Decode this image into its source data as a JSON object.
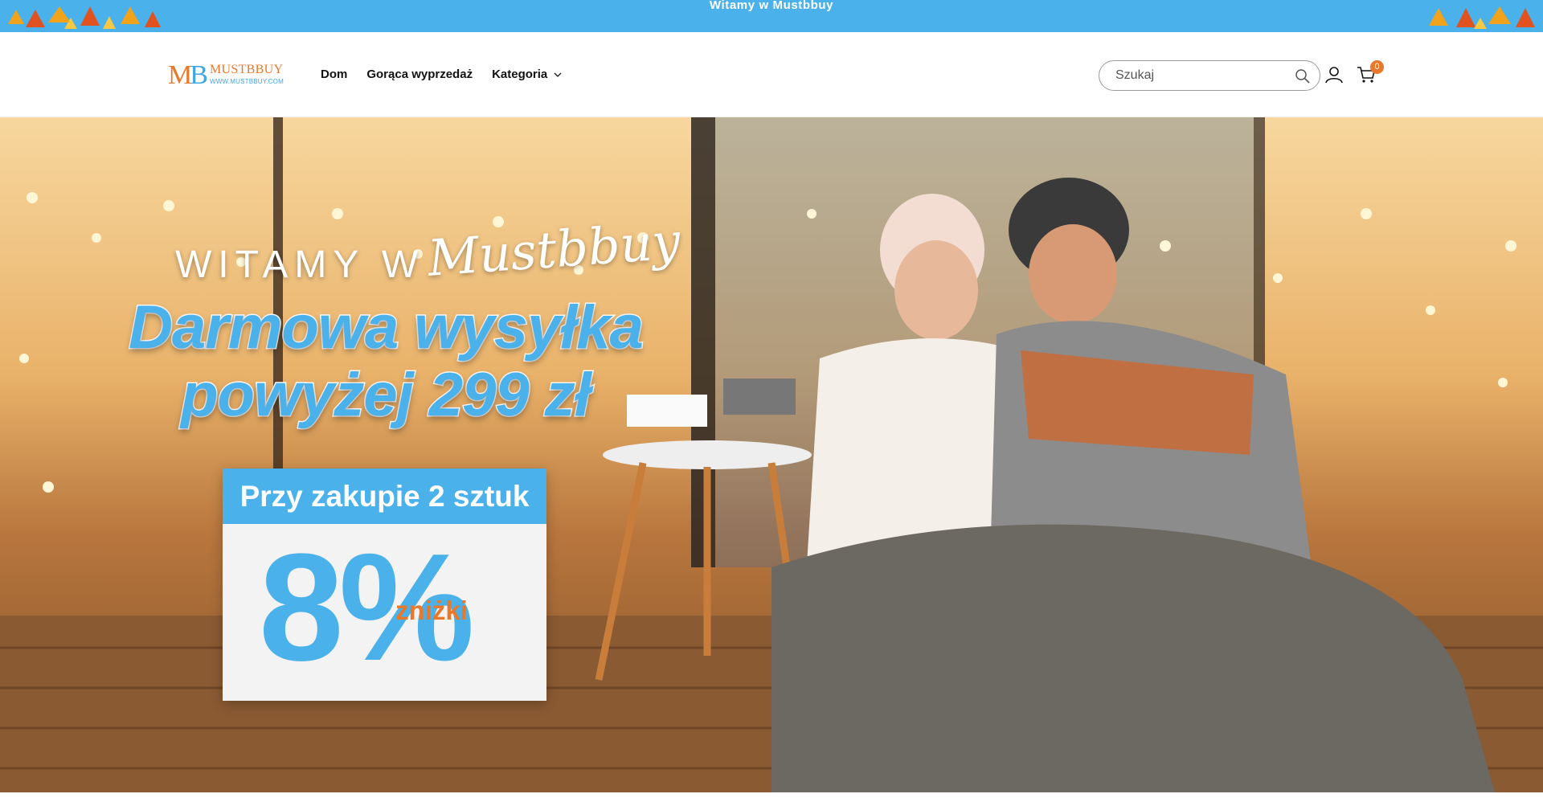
{
  "announcement": {
    "text": "Witamy w Mustbbuy"
  },
  "header": {
    "logo_mark": "MB",
    "logo_name": "MUSTBBUY",
    "logo_url": "WWW.MUSTBBUY.COM",
    "nav": [
      "Dom",
      "Gorąca wyprzedaż",
      "Kategoria"
    ],
    "search_placeholder": "Szukaj",
    "cart_count": "0",
    "icons": [
      "search-icon",
      "account-icon",
      "cart-icon",
      "chevron-down-icon"
    ]
  },
  "hero": {
    "welcome": "WITAMY W",
    "script_brand": "Mustbbuy",
    "headline_1": "Darmowa wysyłka",
    "headline_2": "powyżej 299 zł",
    "promo_top": "Przy zakupie 2 sztuk",
    "promo_value": "8%",
    "promo_sub": "zniżki"
  },
  "colors": {
    "accent_blue": "#4ab1ea",
    "accent_orange": "#e9782a",
    "text": "#121212"
  }
}
